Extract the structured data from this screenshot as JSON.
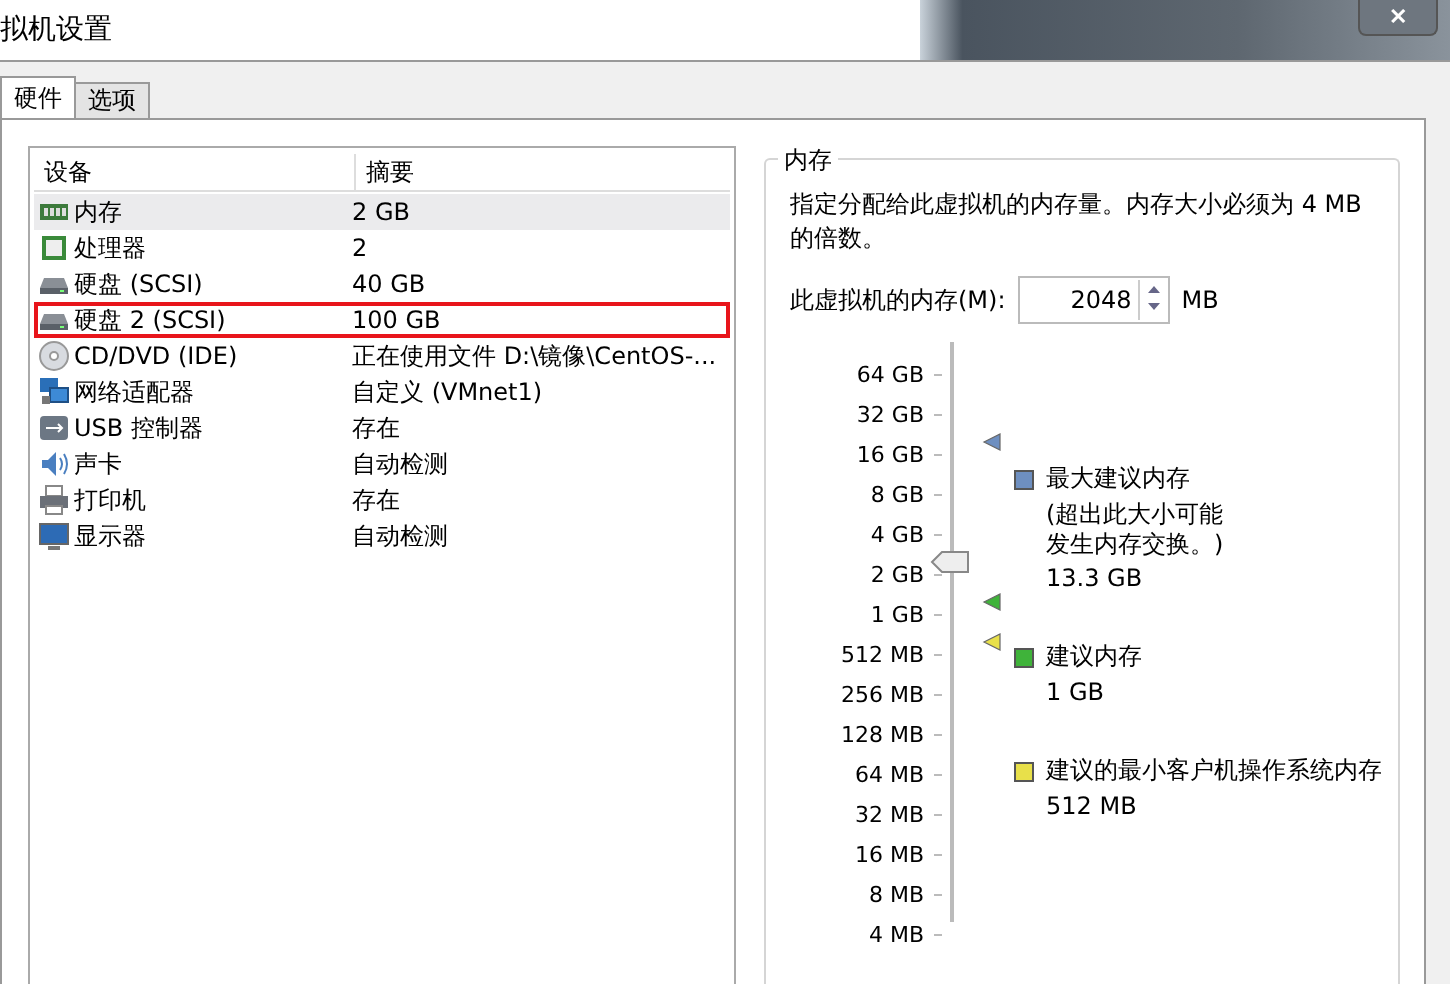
{
  "window": {
    "title": "拟机设置",
    "close": "✕"
  },
  "tabs": [
    {
      "label": "硬件",
      "selected": true
    },
    {
      "label": "选项",
      "selected": false
    }
  ],
  "devices": {
    "columns": [
      "设备",
      "摘要"
    ],
    "rows": [
      {
        "kind": "memory",
        "name": "内存",
        "summary": "2 GB",
        "selected": true,
        "outlined": false
      },
      {
        "kind": "cpu",
        "name": "处理器",
        "summary": "2",
        "selected": false,
        "outlined": false
      },
      {
        "kind": "disk",
        "name": "硬盘 (SCSI)",
        "summary": "40 GB",
        "selected": false,
        "outlined": false
      },
      {
        "kind": "disk",
        "name": "硬盘 2 (SCSI)",
        "summary": "100 GB",
        "selected": false,
        "outlined": true
      },
      {
        "kind": "cd",
        "name": "CD/DVD (IDE)",
        "summary": "正在使用文件 D:\\镜像\\CentOS-...",
        "selected": false,
        "outlined": false
      },
      {
        "kind": "network",
        "name": "网络适配器",
        "summary": "自定义 (VMnet1)",
        "selected": false,
        "outlined": false
      },
      {
        "kind": "usb",
        "name": "USB 控制器",
        "summary": "存在",
        "selected": false,
        "outlined": false
      },
      {
        "kind": "sound",
        "name": "声卡",
        "summary": "自动检测",
        "selected": false,
        "outlined": false
      },
      {
        "kind": "printer",
        "name": "打印机",
        "summary": "存在",
        "selected": false,
        "outlined": false
      },
      {
        "kind": "display",
        "name": "显示器",
        "summary": "自动检测",
        "selected": false,
        "outlined": false
      }
    ]
  },
  "memory": {
    "title": "内存",
    "description": "指定分配给此虚拟机的内存量。内存大小必须为 4 MB 的倍数。",
    "field_label": "此虚拟机的内存(M):",
    "value": "2048",
    "unit": "MB",
    "ticks": [
      "64 GB",
      "32 GB",
      "16 GB",
      "8 GB",
      "4 GB",
      "2 GB",
      "1 GB",
      "512 MB",
      "256 MB",
      "128 MB",
      "64 MB",
      "32 MB",
      "16 MB",
      "8 MB",
      "4 MB"
    ],
    "level": 0.643,
    "markers": [
      {
        "label": "最大建议内存",
        "note": [
          "(超出此大小可能",
          "发生内存交换。)"
        ],
        "value": "13.3 GB",
        "color": "#6e8fc0",
        "level": 0.857
      },
      {
        "label": "建议内存",
        "value": "1 GB",
        "color": "#3fb33a",
        "level": 0.571
      },
      {
        "label": "建议的最小客户机操作系统内存",
        "value": "512 MB",
        "color": "#e8e04a",
        "level": 0.5
      }
    ]
  }
}
